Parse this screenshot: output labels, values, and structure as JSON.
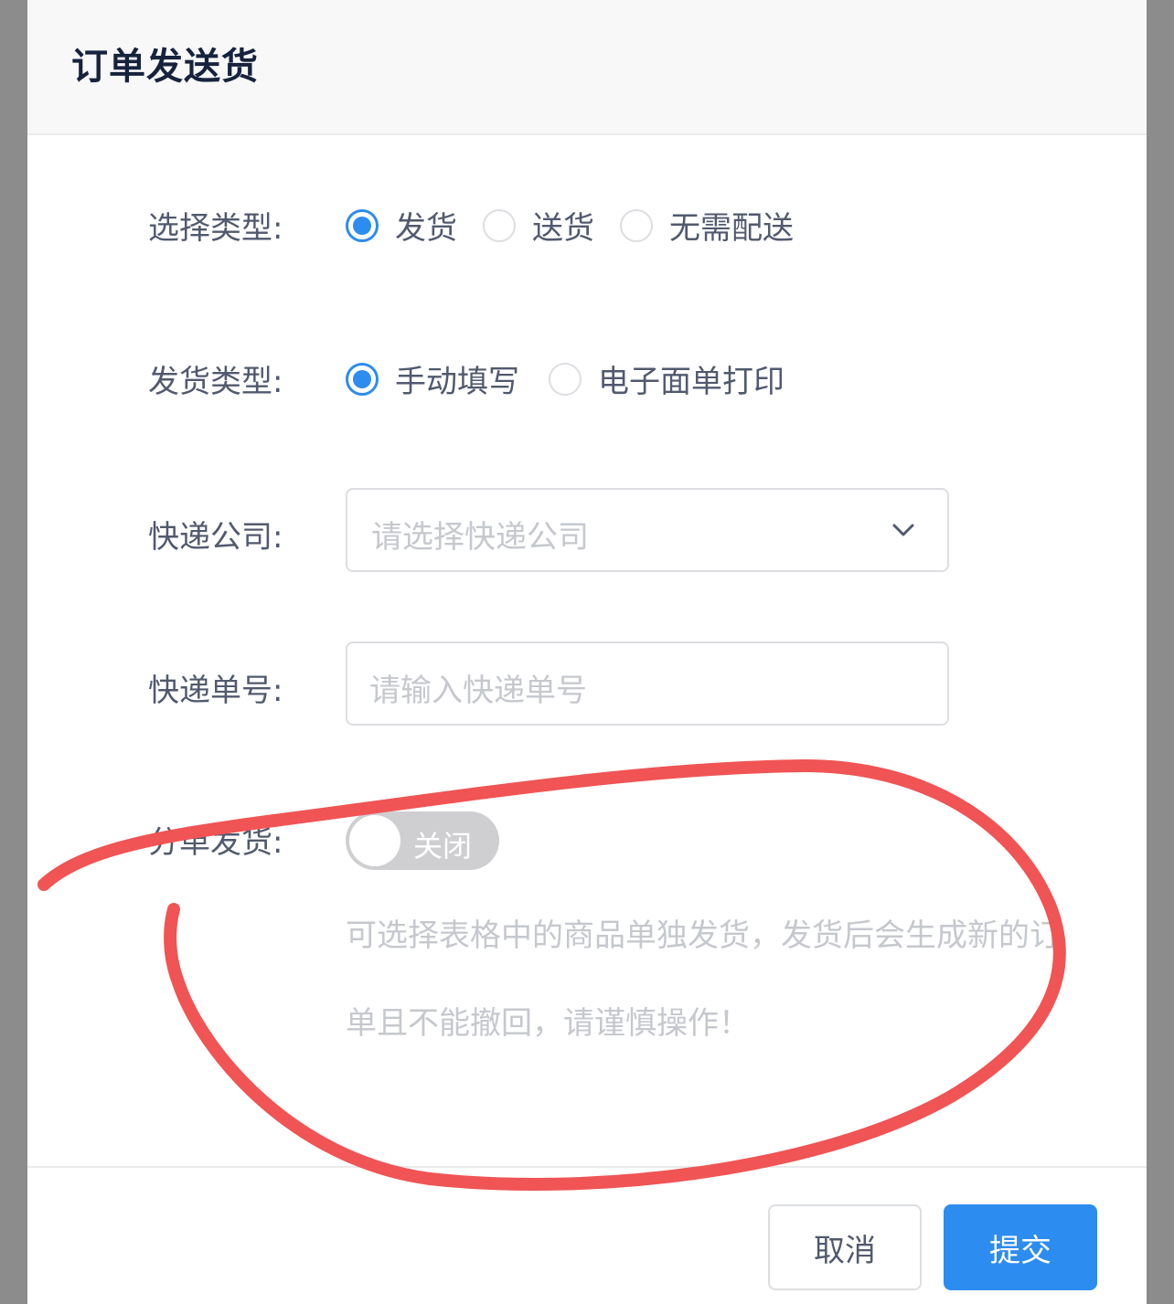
{
  "dialog": {
    "title": "订单发送货"
  },
  "form": {
    "select_type": {
      "label": "选择类型:",
      "options": [
        "发货",
        "送货",
        "无需配送"
      ],
      "selected": "发货"
    },
    "shipping_type": {
      "label": "发货类型:",
      "options": [
        "手动填写",
        "电子面单打印"
      ],
      "selected": "手动填写"
    },
    "courier_company": {
      "label": "快递公司:",
      "placeholder": "请选择快递公司"
    },
    "tracking_number": {
      "label": "快递单号:",
      "placeholder": "请输入快递单号"
    },
    "split_shipment": {
      "label": "分单发货:",
      "switch_text": "关闭",
      "enabled": false
    },
    "tip_line1": "可选择表格中的商品单独发货，发货后会生成新的订",
    "tip_line2": "单且不能撤回，请谨慎操作！"
  },
  "footer": {
    "cancel_label": "取消",
    "submit_label": "提交"
  },
  "colors": {
    "primary": "#2d8cf0",
    "annotation": "#f05454"
  }
}
